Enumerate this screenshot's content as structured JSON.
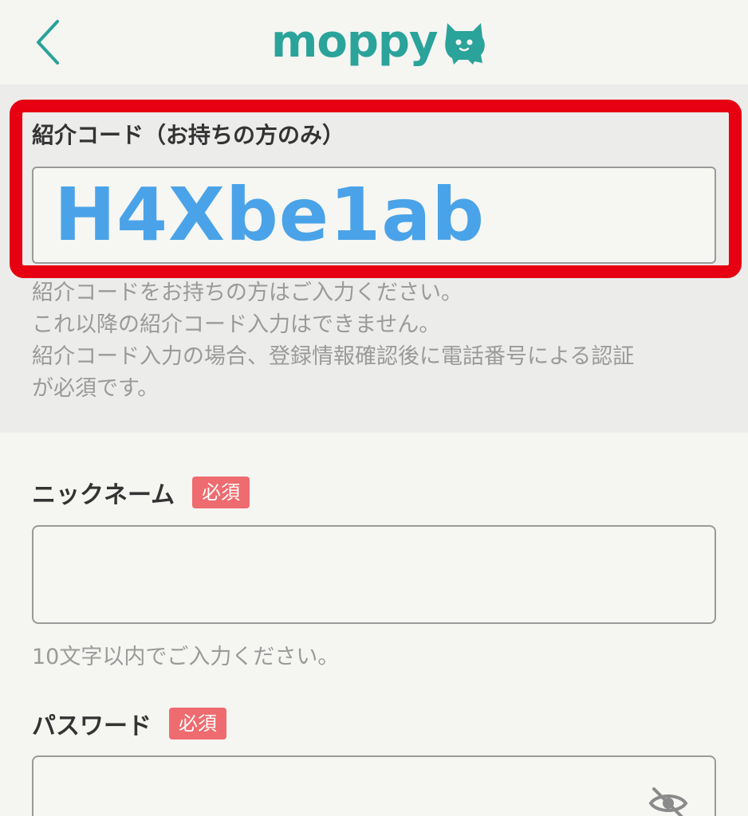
{
  "header": {
    "back_icon": "chevron-left-icon",
    "logo_text": "moppy",
    "logo_mascot_icon": "moppy-mascot-icon",
    "brand_color": "#2aa39a"
  },
  "referral": {
    "label": "紹介コード（お持ちの方のみ）",
    "value": "H4Xbe1ab",
    "value_color": "#4aa3e8",
    "highlight_color": "#e60012",
    "notes": [
      "紹介コードをお持ちの方はご入力ください。",
      "これ以降の紹介コード入力はできません。",
      "紹介コード入力の場合、登録情報確認後に電話番号による認証",
      "が必須です。"
    ]
  },
  "nickname": {
    "label": "ニックネーム",
    "required": "必須",
    "value": "",
    "helper": "10文字以内でご入力ください。"
  },
  "password": {
    "label": "パスワード",
    "required": "必須",
    "value": "",
    "toggle_icon": "eye-off-icon"
  },
  "colors": {
    "required_badge": "#ee6b6f",
    "background": "#f5f5f2",
    "section_background": "#ececeb"
  }
}
